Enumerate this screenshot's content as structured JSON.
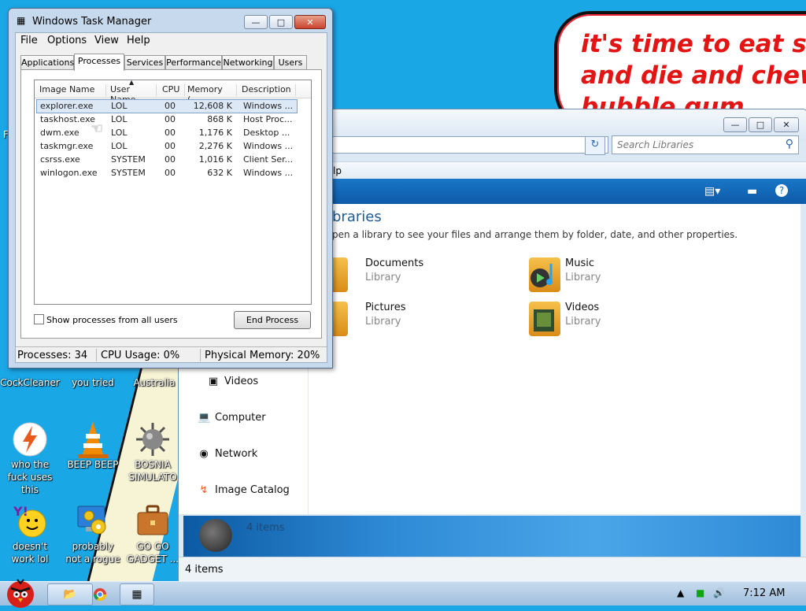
{
  "desktop": {
    "bubble_lines": [
      "it's time to eat shit",
      "and die and chew",
      "bubble gum"
    ],
    "icons": [
      {
        "label": "CockCleaner",
        "icon": "app-icon",
        "color": "#c8102e"
      },
      {
        "label": "you tried",
        "icon": "app-icon",
        "color": "#333333"
      },
      {
        "label": "Australia",
        "icon": "app-icon",
        "color": "#0a7a2a"
      },
      {
        "label": "who the fuck uses this",
        "icon": "lightning-icon",
        "color": "#e85a1c"
      },
      {
        "label": "BEEP BEEP",
        "icon": "traffic-cone-icon",
        "color": "#f08a00"
      },
      {
        "label": "BOSNIA SIMULATO",
        "icon": "spiked-mine-icon",
        "color": "#777777"
      },
      {
        "label": "doesn't work lol",
        "icon": "yahoo-messenger-icon",
        "color": "#7b1fa2"
      },
      {
        "label": "probably not a rogue",
        "icon": "computer-gears-icon",
        "color": "#2a7fd8"
      },
      {
        "label": "GO GO GADGET ...",
        "icon": "briefcase-icon",
        "color": "#b5651d"
      }
    ],
    "stray_letter": "F"
  },
  "task_manager": {
    "title": "Windows Task Manager",
    "menu": [
      "File",
      "Options",
      "View",
      "Help"
    ],
    "tabs": [
      "Applications",
      "Processes",
      "Services",
      "Performance",
      "Networking",
      "Users"
    ],
    "active_tab": "Processes",
    "columns": [
      "Image Name",
      "User Name",
      "CPU",
      "Memory (...",
      "Description"
    ],
    "rows": [
      {
        "image": "explorer.exe",
        "user": "LOL",
        "cpu": "00",
        "mem": "12,608 K",
        "desc": "Windows ...",
        "selected": true
      },
      {
        "image": "taskhost.exe",
        "user": "LOL",
        "cpu": "00",
        "mem": "868 K",
        "desc": "Host Proc..."
      },
      {
        "image": "dwm.exe",
        "user": "LOL",
        "cpu": "00",
        "mem": "1,176 K",
        "desc": "Desktop ..."
      },
      {
        "image": "taskmgr.exe",
        "user": "LOL",
        "cpu": "00",
        "mem": "2,276 K",
        "desc": "Windows ..."
      },
      {
        "image": "csrss.exe",
        "user": "SYSTEM",
        "cpu": "00",
        "mem": "1,016 K",
        "desc": "Client Ser..."
      },
      {
        "image": "winlogon.exe",
        "user": "SYSTEM",
        "cpu": "00",
        "mem": "632 K",
        "desc": "Windows ..."
      }
    ],
    "show_all_label": "Show processes from all users",
    "end_process_label": "End Process",
    "status": {
      "processes": "Processes: 34",
      "cpu": "CPU Usage: 0%",
      "memory": "Physical Memory: 20%"
    }
  },
  "explorer": {
    "search_placeholder": "Search Libraries",
    "menu_fragment": "lp",
    "heading": "braries",
    "subheading": "pen a library to see your files and arrange them by folder, date, and other properties.",
    "libraries": [
      {
        "name": "Documents",
        "type": "Library",
        "icon": "documents-library-icon"
      },
      {
        "name": "Music",
        "type": "Library",
        "icon": "music-library-icon"
      },
      {
        "name": "Pictures",
        "type": "Library",
        "icon": "pictures-library-icon"
      },
      {
        "name": "Videos",
        "type": "Library",
        "icon": "videos-library-icon"
      }
    ],
    "nav": [
      {
        "label": "Videos",
        "icon": "videos-icon"
      },
      {
        "label": "Computer",
        "icon": "computer-icon"
      },
      {
        "label": "Network",
        "icon": "network-icon"
      },
      {
        "label": "Image Catalog",
        "icon": "image-catalog-icon"
      }
    ],
    "details_count": "4 items",
    "status_count": "4 items"
  },
  "taskbar": {
    "clock": "7:12 AM",
    "buttons": [
      "explorer-icon",
      "chrome-icon",
      "task-manager-icon"
    ]
  },
  "colors": {
    "desktop_bg": "#1aa7e6",
    "bubble_text": "#e21414",
    "selection": "#dde8f6"
  }
}
